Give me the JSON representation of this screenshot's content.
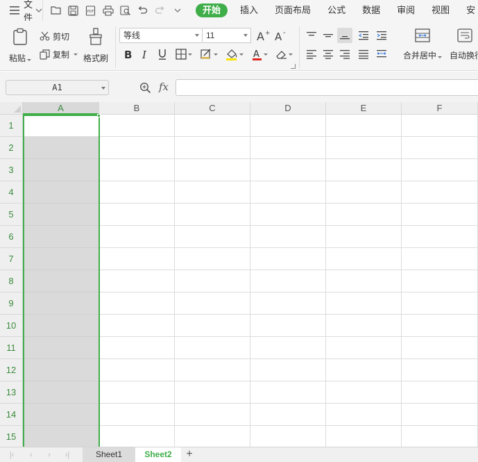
{
  "menubar": {
    "file_label": "文件",
    "tabs": [
      "开始",
      "插入",
      "页面布局",
      "公式",
      "数据",
      "审阅",
      "视图",
      "安"
    ]
  },
  "ribbon": {
    "paste_label": "粘贴",
    "cut_label": "剪切",
    "copy_label": "复制",
    "format_painter_label": "格式刷",
    "font_name": "等线",
    "font_size": "11",
    "merge_center_label": "合并居中",
    "auto_wrap_label": "自动换行"
  },
  "formula_bar": {
    "name_box": "A1",
    "fx_label": "fx",
    "formula": ""
  },
  "grid": {
    "columns": [
      "A",
      "B",
      "C",
      "D",
      "E",
      "F"
    ],
    "rows": [
      "1",
      "2",
      "3",
      "4",
      "5",
      "6",
      "7",
      "8",
      "9",
      "10",
      "11",
      "12",
      "13",
      "14",
      "15"
    ],
    "selected_column": "A",
    "active_cell": "A1"
  },
  "sheets": {
    "tabs": [
      "Sheet1",
      "Sheet2"
    ],
    "active": "Sheet2",
    "add_label": "+"
  },
  "colors": {
    "accent_green": "#3fae49",
    "header_bg": "#efefef",
    "selected_col_bg": "#dadada"
  }
}
